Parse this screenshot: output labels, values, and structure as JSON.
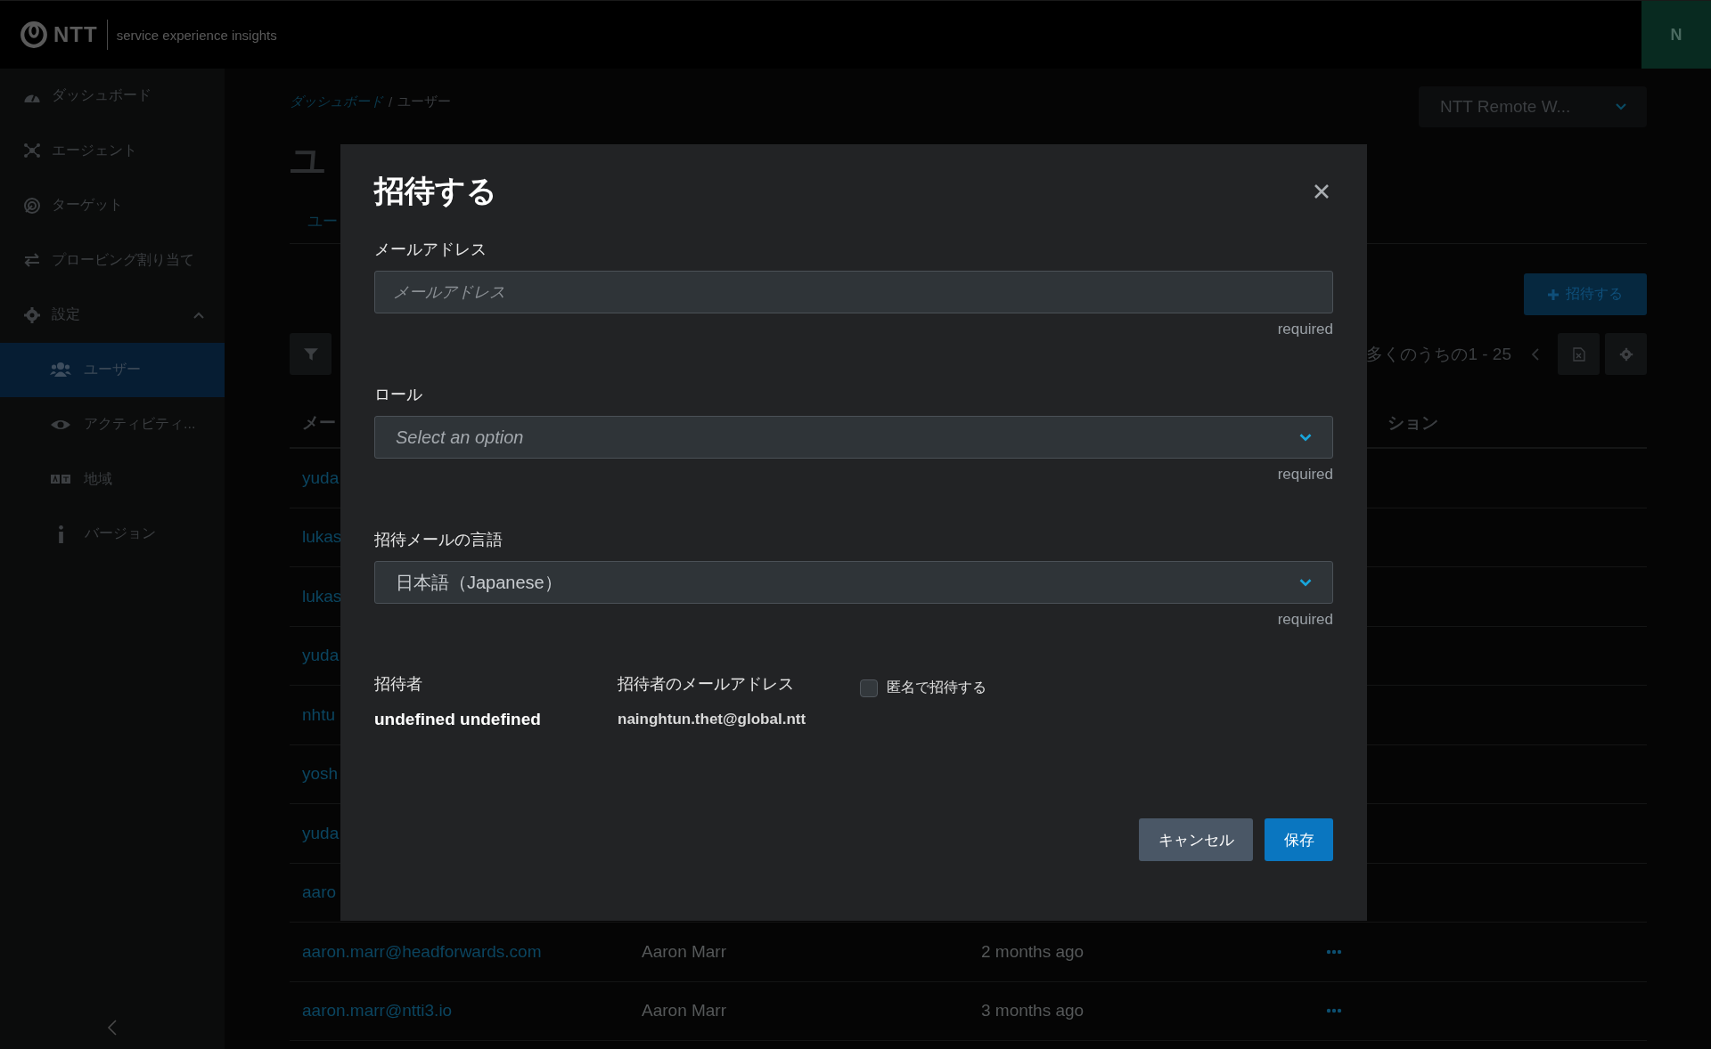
{
  "header": {
    "logo_text": "NTT",
    "tagline": "service experience insights",
    "avatar": "N"
  },
  "sidebar": {
    "items": [
      {
        "label": "ダッシュボード",
        "selected": false
      },
      {
        "label": "エージェント",
        "selected": false
      },
      {
        "label": "ターゲット",
        "selected": false
      },
      {
        "label": "プロービング割り当て",
        "selected": false
      },
      {
        "label": "設定",
        "selected": false,
        "expanded": true,
        "children": [
          {
            "label": "ユーザー",
            "selected": true
          },
          {
            "label": "アクティビティ...",
            "selected": false
          },
          {
            "label": "地域",
            "selected": false
          },
          {
            "label": "バージョン",
            "selected": false
          }
        ]
      }
    ]
  },
  "breadcrumb": {
    "items": [
      "ダッシュボード",
      "ユーザー"
    ],
    "separator": "/"
  },
  "workspace_select": {
    "value": "NTT Remote W..."
  },
  "page_title": "ユ",
  "tabs": [
    {
      "label": "ユー",
      "selected": false
    }
  ],
  "invite_button": "招待する",
  "pagination": {
    "range": "多くのうちの1 - 25"
  },
  "table": {
    "columns": [
      "メー",
      "ション"
    ],
    "rows": [
      {
        "email": "yuda"
      },
      {
        "email": "lukas"
      },
      {
        "email": "lukas"
      },
      {
        "email": "yuda"
      },
      {
        "email": "nhtu"
      },
      {
        "email": "yosh"
      },
      {
        "email": "yuda"
      },
      {
        "email": "aaro"
      },
      {
        "email": "aaron.marr@headforwards.com",
        "name": "Aaron Marr",
        "invited": "2 months ago"
      },
      {
        "email": "aaron.marr@ntti3.io",
        "name": "Aaron Marr",
        "invited": "3 months ago"
      }
    ]
  },
  "modal": {
    "title": "招待する",
    "email": {
      "label": "メールアドレス",
      "placeholder": "メールアドレス",
      "hint": "required"
    },
    "role": {
      "label": "ロール",
      "placeholder": "Select an option",
      "hint": "required"
    },
    "language": {
      "label": "招待メールの言語",
      "value": "日本語（Japanese）",
      "hint": "required"
    },
    "inviter": {
      "label": "招待者",
      "value": "undefined undefined"
    },
    "inviter_email": {
      "label": "招待者のメールアドレス",
      "value": "nainghtun.thet@global.ntt"
    },
    "anonymous": {
      "label": "匿名で招待する",
      "checked": false
    },
    "buttons": [
      {
        "label": "キャンセル",
        "kind": "secondary"
      },
      {
        "label": "保存",
        "kind": "primary"
      }
    ]
  }
}
